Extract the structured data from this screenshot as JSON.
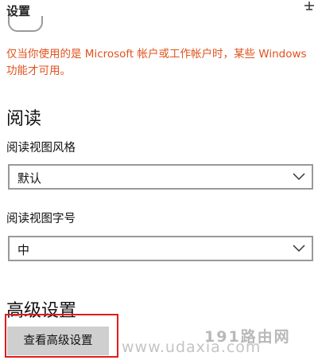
{
  "header": {
    "title": "设置",
    "pin_icon": "pin-icon"
  },
  "notice": {
    "text": "仅当你使用的是 Microsoft 帐户或工作帐户时，某些 Windows 功能才可用。",
    "color": "#e0521d"
  },
  "reading": {
    "heading": "阅读",
    "style_label": "阅读视图风格",
    "style_value": "默认",
    "font_size_label": "阅读视图字号",
    "font_size_value": "中"
  },
  "advanced": {
    "heading": "高级设置",
    "button_label": "查看高级设置"
  },
  "watermark": {
    "url": "www.udaxia.com",
    "brand": "191路由网"
  },
  "colors": {
    "highlight": "#e21b1b",
    "button_bg": "#cfcfcf"
  }
}
